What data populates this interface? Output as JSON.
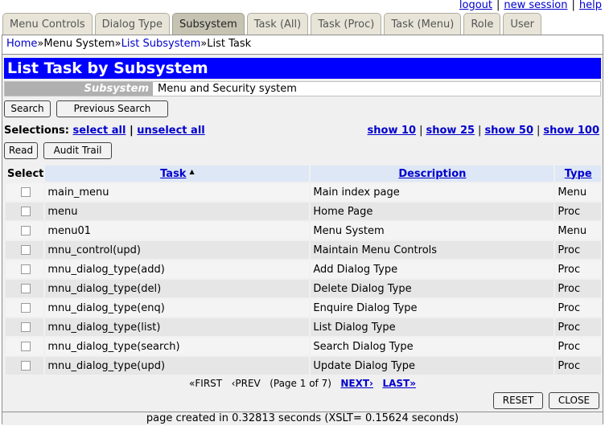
{
  "top_links": {
    "logout": "logout",
    "new_session": "new session",
    "help": "help",
    "separator": "|"
  },
  "tabs": [
    {
      "label": "Menu Controls",
      "active": false
    },
    {
      "label": "Dialog Type",
      "active": false
    },
    {
      "label": "Subsystem",
      "active": true
    },
    {
      "label": "Task (All)",
      "active": false
    },
    {
      "label": "Task (Proc)",
      "active": false
    },
    {
      "label": "Task (Menu)",
      "active": false
    },
    {
      "label": "Role",
      "active": false
    },
    {
      "label": "User",
      "active": false
    }
  ],
  "breadcrumb": {
    "home": "Home",
    "sep": "»",
    "menu_system": "Menu System",
    "list_subsystem": "List Subsystem",
    "current": "List Task"
  },
  "page_title": "List Task by Subsystem",
  "subsystem": {
    "label": "Subsystem",
    "value": "Menu and Security system"
  },
  "buttons": {
    "search": "Search",
    "previous_search": "Previous Search",
    "read": "Read",
    "audit_trail": "Audit Trail",
    "reset": "RESET",
    "close": "CLOSE"
  },
  "selections": {
    "label": "Selections:",
    "select_all": "select all",
    "sep": "|",
    "unselect_all": "unselect all"
  },
  "show_links": [
    "show 10",
    "show 25",
    "show 50",
    "show 100"
  ],
  "table": {
    "headers": {
      "select": "Select",
      "task": "Task",
      "description": "Description",
      "type": "Type"
    },
    "sort_indicator": "▲",
    "rows": [
      {
        "task": "main_menu",
        "description": "Main index page",
        "type": "Menu"
      },
      {
        "task": "menu",
        "description": "Home Page",
        "type": "Proc"
      },
      {
        "task": "menu01",
        "description": "Menu System",
        "type": "Menu"
      },
      {
        "task": "mnu_control(upd)",
        "description": "Maintain Menu Controls",
        "type": "Proc"
      },
      {
        "task": "mnu_dialog_type(add)",
        "description": "Add Dialog Type",
        "type": "Proc"
      },
      {
        "task": "mnu_dialog_type(del)",
        "description": "Delete Dialog Type",
        "type": "Proc"
      },
      {
        "task": "mnu_dialog_type(enq)",
        "description": "Enquire Dialog Type",
        "type": "Proc"
      },
      {
        "task": "mnu_dialog_type(list)",
        "description": "List Dialog Type",
        "type": "Proc"
      },
      {
        "task": "mnu_dialog_type(search)",
        "description": "Search Dialog Type",
        "type": "Proc"
      },
      {
        "task": "mnu_dialog_type(upd)",
        "description": "Update Dialog Type",
        "type": "Proc"
      }
    ]
  },
  "pager": {
    "first": "«FIRST",
    "prev": "‹PREV",
    "page_info": "(Page 1 of 7)",
    "next": "NEXT›",
    "last": "LAST»"
  },
  "footer": "page created in 0.32813 seconds (XSLT= 0.15624 seconds)"
}
